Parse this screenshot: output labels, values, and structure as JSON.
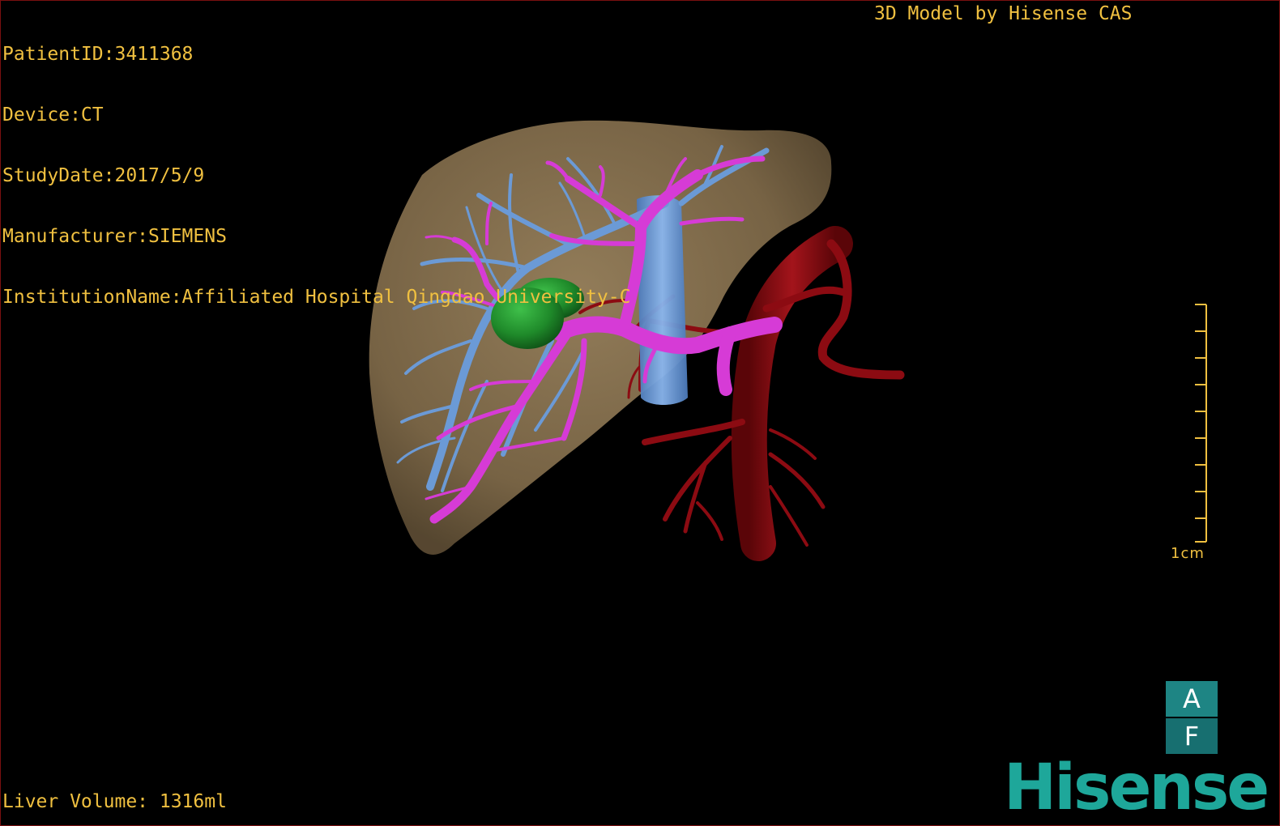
{
  "study_info": {
    "patient_id": "PatientID:3411368",
    "device": "Device:CT",
    "study_date": "StudyDate:2017/5/9",
    "manufacturer": "Manufacturer:SIEMENS",
    "institution": "InstitutionName:Affiliated Hospital Qingdao University-C"
  },
  "viewer": {
    "title": "3D Model by Hisense CAS",
    "liver_volume": "Liver Volume: 1316ml"
  },
  "scale_bar": {
    "label": "1cm",
    "tick_count": 10
  },
  "orientation": {
    "top_face": "A",
    "bottom_face": "F"
  },
  "brand": {
    "logo_text": "Hisense"
  },
  "colors": {
    "text": "#f0c040",
    "liver": "#8a7350",
    "hepatic_vein": "#6b9ad6",
    "portal_vein": "#d63bd6",
    "tumor": "#1f8a2a",
    "artery": "#8c0b12",
    "brand": "#1ea79a"
  },
  "model_parts": [
    "liver-icon",
    "hepatic-vein-icon",
    "portal-vein-icon",
    "tumor-icon",
    "aorta-icon"
  ]
}
